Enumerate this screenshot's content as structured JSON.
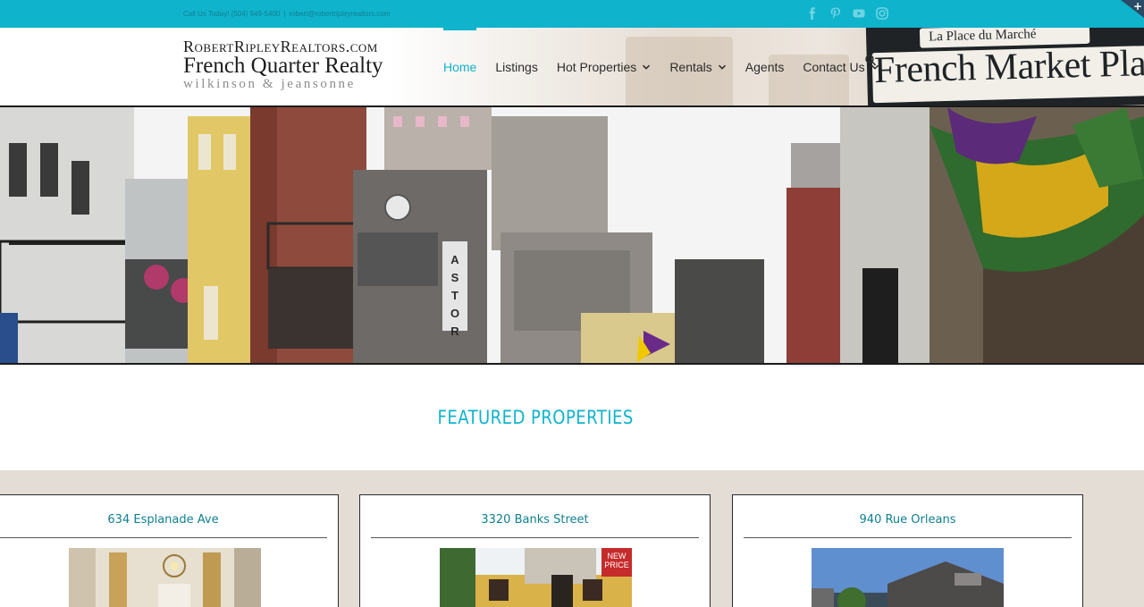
{
  "topbar": {
    "phone_text": "Call Us Today! (504) 949-5400",
    "separator": "|",
    "email_text": "robert@robertripleyrealtors.com",
    "social_icons": [
      "facebook-icon",
      "pinterest-icon",
      "youtube-icon",
      "instagram-icon"
    ],
    "accent_color": "#10b3cc"
  },
  "logo": {
    "line1": "RobertRipleyRealtors.com",
    "line2": "French Quarter Realty",
    "line3": "wilkinson & jeansonne"
  },
  "nav": {
    "items": [
      {
        "label": "Home",
        "active": true,
        "dropdown": false
      },
      {
        "label": "Listings",
        "active": false,
        "dropdown": false
      },
      {
        "label": "Hot Properties",
        "active": false,
        "dropdown": true
      },
      {
        "label": "Rentals",
        "active": false,
        "dropdown": true
      },
      {
        "label": "Agents",
        "active": false,
        "dropdown": false
      },
      {
        "label": "Contact Us",
        "active": false,
        "dropdown": true
      }
    ]
  },
  "header_sign": {
    "top_text": "La Place du Marché",
    "main_text": "French Market Place"
  },
  "hero": {
    "building_sign": "ASTOR"
  },
  "featured": {
    "title": "FEATURED PROPERTIES"
  },
  "listings": [
    {
      "address": "634 Esplanade Ave"
    },
    {
      "address": "3320 Banks Street",
      "badge": "NEW PRICE"
    },
    {
      "address": "940 Rue Orleans"
    }
  ]
}
